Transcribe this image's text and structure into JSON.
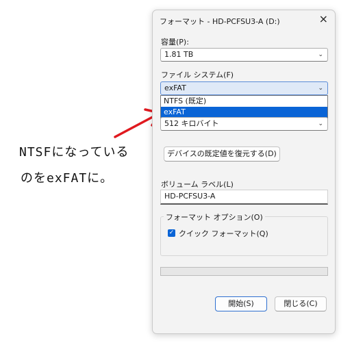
{
  "dialog": {
    "title": "フォーマット - HD-PCFSU3-A (D:)",
    "close_icon": "close-icon",
    "capacity": {
      "label": "容量(P):",
      "value": "1.81 TB"
    },
    "filesystem": {
      "label": "ファイル システム(F)",
      "value": "exFAT",
      "options": [
        "NTFS (既定)",
        "exFAT"
      ],
      "selected_index": 1
    },
    "allocation": {
      "value": "512 キロバイト"
    },
    "restore_button": "デバイスの既定値を復元する(D)",
    "volume_label": {
      "label": "ボリューム ラベル(L)",
      "value": "HD-PCFSU3-A"
    },
    "format_options": {
      "legend": "フォーマット オプション(O)",
      "quick_format_label": "クイック フォーマット(Q)",
      "quick_format_checked": true
    },
    "progress": 0,
    "start_button": "開始(S)",
    "close_button": "閉じる(C)"
  },
  "annotation": {
    "line1": "NTSFになっている",
    "line2": "のをexFATに。",
    "arrow_color": "#e0191f"
  }
}
